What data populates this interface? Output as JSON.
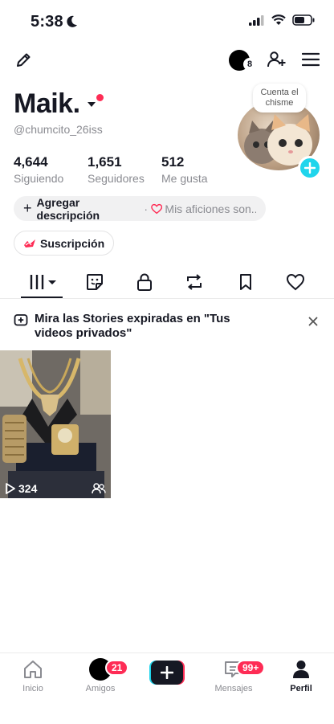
{
  "status_bar": {
    "time": "5:38"
  },
  "top_bar": {
    "story_count": "8"
  },
  "profile": {
    "name": "Maik.",
    "handle": "@chumcito_26iss",
    "stats": [
      {
        "value": "4,644",
        "label": "Siguiendo"
      },
      {
        "value": "1,651",
        "label": "Seguidores"
      },
      {
        "value": "512",
        "label": "Me gusta"
      }
    ],
    "bubble": "Cuenta el chisme",
    "add_description": "Agregar descripción",
    "separator": "·",
    "hobbies": "Mis aficiones son...",
    "subscription": "Suscripción"
  },
  "tabs": [
    "videos-grid-icon",
    "stickers-icon",
    "lock-icon",
    "repost-icon",
    "bookmark-icon",
    "heart-icon"
  ],
  "banner": {
    "text": "Mira las Stories expiradas en \"Tus videos privados\""
  },
  "video": {
    "plays": "324"
  },
  "bottom_nav": {
    "items": [
      {
        "label": "Inicio"
      },
      {
        "label": "Amigos",
        "badge": "21"
      },
      {
        "label": "Mensajes",
        "badge": "99+"
      },
      {
        "label": "Perfil"
      }
    ]
  },
  "colors": {
    "accent_red": "#fe2c55",
    "accent_cyan": "#20d5ec",
    "text": "#161823",
    "muted": "#8a8b91"
  }
}
